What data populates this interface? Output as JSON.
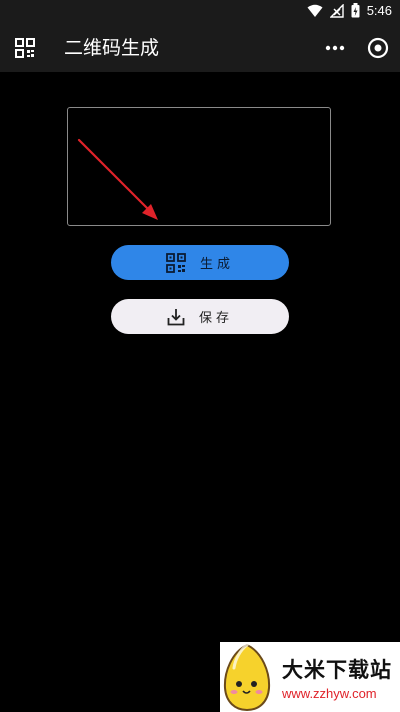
{
  "status_bar": {
    "time": "5:46"
  },
  "app_bar": {
    "title": "二维码生成"
  },
  "input": {
    "value": "",
    "placeholder": ""
  },
  "buttons": {
    "generate_label": "生成",
    "save_label": "保存"
  },
  "watermark": {
    "title": "大米下载站",
    "url": "www.zzhyw.com"
  },
  "colors": {
    "accent": "#2f86e8",
    "save_bg": "#f1eef3",
    "bar_bg": "#1b1b1b",
    "arrow": "#e0232a"
  },
  "icons": [
    "wifi-icon",
    "signal-icon",
    "battery-icon",
    "qr-code-icon",
    "more-icon",
    "target-icon",
    "download-icon",
    "arrow-annotation-icon",
    "mascot-logo"
  ]
}
